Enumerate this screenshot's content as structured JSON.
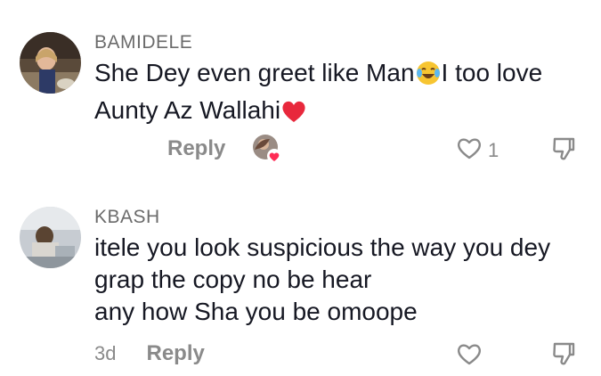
{
  "comments": [
    {
      "username": "BAMIDELE",
      "text_lines": [
        "She Dey even greet like Man",
        "I too love",
        "Aunty Az Wallahi"
      ],
      "emojis": [
        "joy-emoji",
        "red-heart-emoji"
      ],
      "reply_label": "Reply",
      "like_count": "1",
      "liked_by_creator": true
    },
    {
      "username": "KBASH",
      "text_lines": [
        "itele you look suspicious the way you dey",
        "grap the copy no be hear",
        "any how Sha you be omoope"
      ],
      "time": "3d",
      "reply_label": "Reply"
    }
  ],
  "colors": {
    "username": "#6b6b6b",
    "text": "#161823",
    "muted": "#8a8a8a",
    "heart_red": "#e8283c",
    "badge_pink": "#fe2c55"
  },
  "icons": [
    "heart-outline-icon",
    "dislike-icon",
    "creator-liked-badge-icon"
  ]
}
